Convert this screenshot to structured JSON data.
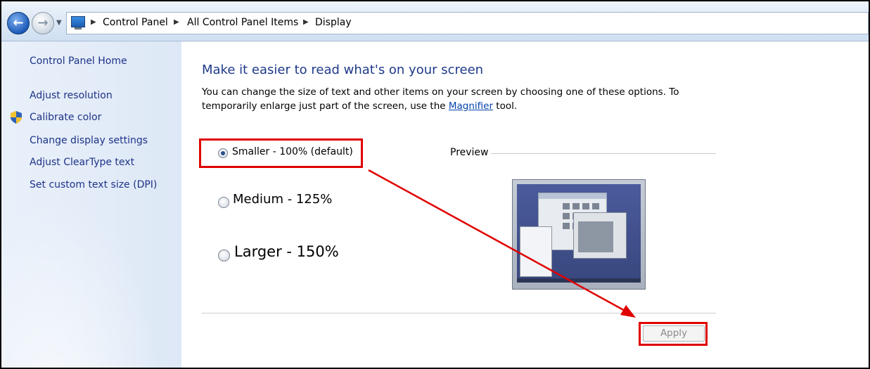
{
  "breadcrumb": {
    "items": [
      "Control Panel",
      "All Control Panel Items",
      "Display"
    ]
  },
  "sidebar": {
    "home": "Control Panel Home",
    "links": [
      "Adjust resolution",
      "Calibrate color",
      "Change display settings",
      "Adjust ClearType text",
      "Set custom text size (DPI)"
    ]
  },
  "main": {
    "heading": "Make it easier to read what's on your screen",
    "desc_pre": "You can change the size of text and other items on your screen by choosing one of these options. To temporarily enlarge just part of the screen, use the ",
    "desc_link": "Magnifier",
    "desc_post": " tool.",
    "options": [
      {
        "label": "Smaller - 100% (default)",
        "selected": true
      },
      {
        "label": "Medium - 125%",
        "selected": false
      },
      {
        "label": "Larger - 150%",
        "selected": false
      }
    ],
    "preview_label": "Preview",
    "apply_label": "Apply"
  },
  "colors": {
    "highlight": "#e00000",
    "link": "#1e3287",
    "heading": "#1e3a8a"
  }
}
